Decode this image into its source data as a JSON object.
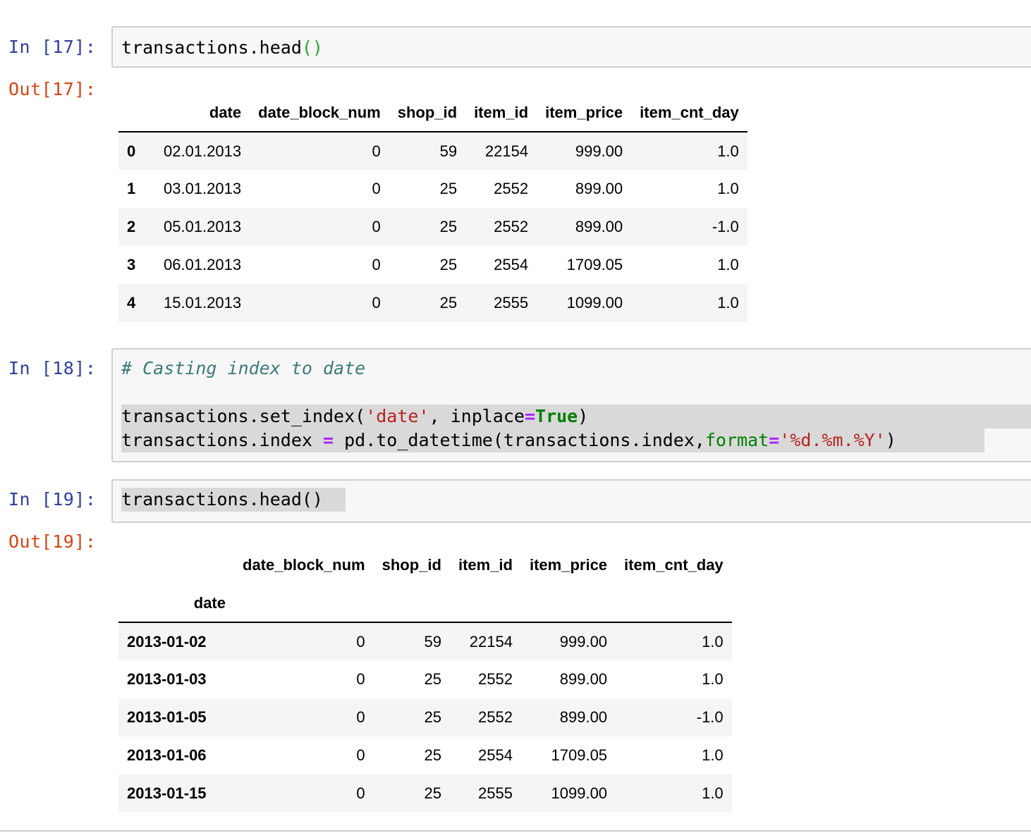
{
  "cells": [
    {
      "in_prompt": "In [17]:",
      "code": "transactions.head",
      "code_parens": "()",
      "out_prompt": "Out[17]:"
    },
    {
      "in_prompt": "In [18]:",
      "comment": "# Casting index to date",
      "line1": {
        "a": "transactions.set_index(",
        "str": "'date'",
        "b": ", inplace",
        "op": "=",
        "kw": "True",
        "c": ")"
      },
      "line2": {
        "a": "transactions.index ",
        "op": "=",
        "b": " pd.to_datetime(transactions.index,",
        "kwarg": "format",
        "op2": "=",
        "str": "'%d.%m.%Y'",
        "c": ")"
      }
    },
    {
      "in_prompt": "In [19]:",
      "code": "transactions.head()",
      "out_prompt": "Out[19]:"
    }
  ],
  "table1": {
    "columns": [
      "",
      "date",
      "date_block_num",
      "shop_id",
      "item_id",
      "item_price",
      "item_cnt_day"
    ],
    "rows": [
      [
        "0",
        "02.01.2013",
        "0",
        "59",
        "22154",
        "999.00",
        "1.0"
      ],
      [
        "1",
        "03.01.2013",
        "0",
        "25",
        "2552",
        "899.00",
        "1.0"
      ],
      [
        "2",
        "05.01.2013",
        "0",
        "25",
        "2552",
        "899.00",
        "-1.0"
      ],
      [
        "3",
        "06.01.2013",
        "0",
        "25",
        "2554",
        "1709.05",
        "1.0"
      ],
      [
        "4",
        "15.01.2013",
        "0",
        "25",
        "2555",
        "1099.00",
        "1.0"
      ]
    ]
  },
  "table2": {
    "columns": [
      "",
      "date_block_num",
      "shop_id",
      "item_id",
      "item_price",
      "item_cnt_day"
    ],
    "index_name": "date",
    "rows": [
      [
        "2013-01-02",
        "0",
        "59",
        "22154",
        "999.00",
        "1.0"
      ],
      [
        "2013-01-03",
        "0",
        "25",
        "2552",
        "899.00",
        "1.0"
      ],
      [
        "2013-01-05",
        "0",
        "25",
        "2552",
        "899.00",
        "-1.0"
      ],
      [
        "2013-01-06",
        "0",
        "25",
        "2554",
        "1709.05",
        "1.0"
      ],
      [
        "2013-01-15",
        "0",
        "25",
        "2555",
        "1099.00",
        "1.0"
      ]
    ]
  }
}
